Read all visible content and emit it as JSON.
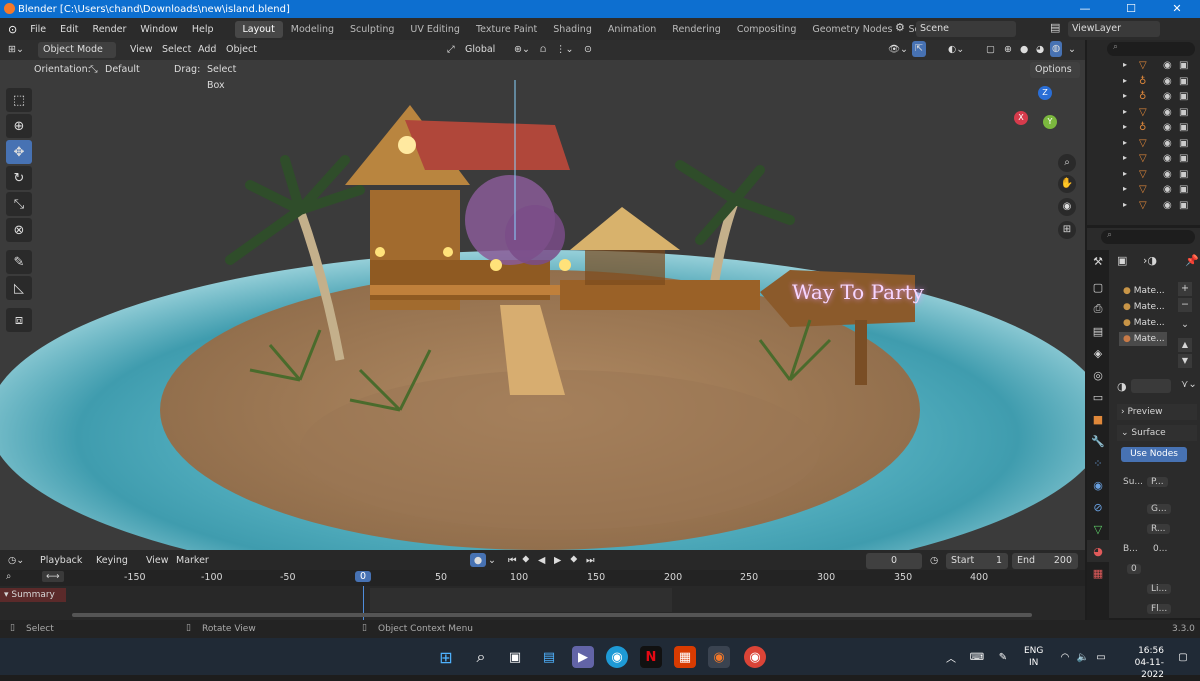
{
  "window": {
    "title": "Blender [C:\\Users\\chand\\Downloads\\new\\island.blend]",
    "minimize": "—",
    "maximize": "☐",
    "close": "✕"
  },
  "menu": {
    "items": [
      "File",
      "Edit",
      "Render",
      "Window",
      "Help"
    ],
    "workspaces": [
      "Layout",
      "Modeling",
      "Sculpting",
      "UV Editing",
      "Texture Paint",
      "Shading",
      "Animation",
      "Rendering",
      "Compositing",
      "Geometry Nodes",
      "Scripting"
    ],
    "add_tab": "+",
    "scene_label": "Scene",
    "viewlayer_label": "ViewLayer"
  },
  "viewport_header": {
    "mode": "Object Mode",
    "menus": [
      "View",
      "Select",
      "Add",
      "Object"
    ],
    "transform_orientation": "Global",
    "options": "Options",
    "orientation_label": "Orientation:",
    "orientation_value": "Default",
    "drag_label": "Drag:",
    "drag_value": "Select Box"
  },
  "scene": {
    "sign_text": "Way To Party",
    "gizmo_axes": [
      "Z",
      "X",
      "Y"
    ]
  },
  "properties": {
    "materials": [
      "Mate...",
      "Mate...",
      "Mate...",
      "Mate..."
    ],
    "preview": "Preview",
    "surface": "Surface",
    "use_nodes": "Use Nodes",
    "rows": [
      "Su...",
      "P...",
      "G...",
      "R...",
      "B...",
      "0...",
      "0",
      "Li...",
      "Fl..."
    ]
  },
  "timeline": {
    "menus": [
      "Playback",
      "Keying",
      "View",
      "Marker"
    ],
    "current_frame": "0",
    "start_label": "Start",
    "start": "1",
    "end_label": "End",
    "end": "200",
    "ruler": [
      "-150",
      "-100",
      "-50",
      "0",
      "50",
      "100",
      "150",
      "200",
      "250",
      "300",
      "350",
      "400"
    ],
    "summary": "Summary"
  },
  "status": {
    "select": "Select",
    "rotate": "Rotate View",
    "context": "Object Context Menu",
    "version": "3.3.0"
  },
  "taskbar": {
    "language": "ENG",
    "region": "IN",
    "time": "16:56",
    "date": "04-11-2022"
  },
  "colors": {
    "accent": "#4772b3",
    "titlebar": "#0d6fd0",
    "sign_glow": "#f2c8ff"
  }
}
